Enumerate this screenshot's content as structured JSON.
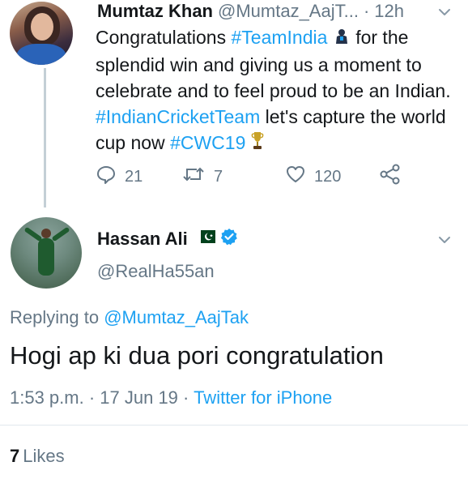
{
  "tweet1": {
    "author_name": "Mumtaz Khan",
    "handle": "@Mumtaz_AajT...",
    "separator": "·",
    "time": "12h",
    "body": {
      "t1": "Congratulations ",
      "h1": "#TeamIndia",
      "t2": " for the splendid win and giving us a moment to celebrate and to feel proud to be an Indian. ",
      "h2": "#IndianCricketTeam",
      "t3": " let's capture the world cup now ",
      "h3": "#CWC19"
    },
    "actions": {
      "reply_count": "21",
      "retweet_count": "7",
      "like_count": "120"
    }
  },
  "tweet2": {
    "author_name": "Hassan Ali",
    "handle": "@RealHa55an",
    "replying_label": "Replying to ",
    "replying_mention": "@Mumtaz_AajTak",
    "text": "Hogi ap ki dua pori congratulation",
    "time": "1:53 p.m.",
    "sep1": " · ",
    "date": "17 Jun 19",
    "sep2": " · ",
    "source": "Twitter for iPhone",
    "likes_count": "7",
    "likes_label": "Likes"
  },
  "colors": {
    "accent": "#1da1f2",
    "muted": "#657786",
    "text": "#14171a",
    "verified": "#1da1f2"
  },
  "icons": [
    "chevron-down-icon",
    "reply-icon",
    "retweet-icon",
    "heart-icon",
    "share-icon",
    "pakistan-flag-icon",
    "verified-badge-icon",
    "cricket-shirt-emoji",
    "trophy-emoji"
  ]
}
